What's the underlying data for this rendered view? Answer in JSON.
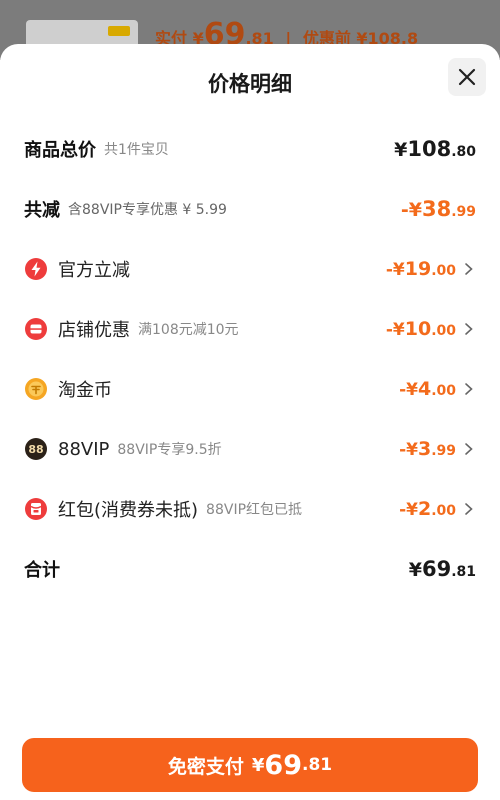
{
  "background": {
    "price_prefix": "实付 ¥",
    "price_int": "69",
    "price_dec": ".81",
    "divider": "|",
    "original_label": "优惠前 ¥108.8"
  },
  "sheet": {
    "title": "价格明细"
  },
  "rows": {
    "total": {
      "label": "商品总价",
      "sub": "共1件宝贝",
      "cur": "¥",
      "int": "108",
      "dec": ".80"
    },
    "reduction": {
      "label": "共减",
      "sub": "含88VIP专享优惠 ¥ 5.99",
      "cur": "-¥",
      "int": "38",
      "dec": ".99"
    },
    "official": {
      "label": "官方立减",
      "cur": "-¥",
      "int": "19",
      "dec": ".00",
      "icon": "lightning-icon"
    },
    "store": {
      "label": "店铺优惠",
      "sub": "满108元减10元",
      "cur": "-¥",
      "int": "10",
      "dec": ".00",
      "icon": "store-coupon-icon"
    },
    "coins": {
      "label": "淘金币",
      "cur": "-¥",
      "int": "4",
      "dec": ".00",
      "icon": "coin-icon"
    },
    "vip": {
      "label": "88VIP",
      "sub": "88VIP专享9.5折",
      "cur": "-¥",
      "int": "3",
      "dec": ".99",
      "icon": "vip-badge-icon",
      "icon_text": "88"
    },
    "redpacket": {
      "label": "红包(消费券未抵)",
      "sub": "88VIP红包已抵",
      "cur": "-¥",
      "int": "2",
      "dec": ".00",
      "icon": "red-packet-icon"
    },
    "sum": {
      "label": "合计",
      "cur": "¥",
      "int": "69",
      "dec": ".81"
    }
  },
  "pay_button": {
    "label": "免密支付",
    "cur": "¥",
    "int": "69",
    "dec": ".81"
  },
  "colors": {
    "accent": "#f36b1c",
    "button": "#f6621c",
    "red_icon": "#ee3c3c",
    "coin_icon": "#f5a623",
    "vip_icon": "#2b2118"
  }
}
